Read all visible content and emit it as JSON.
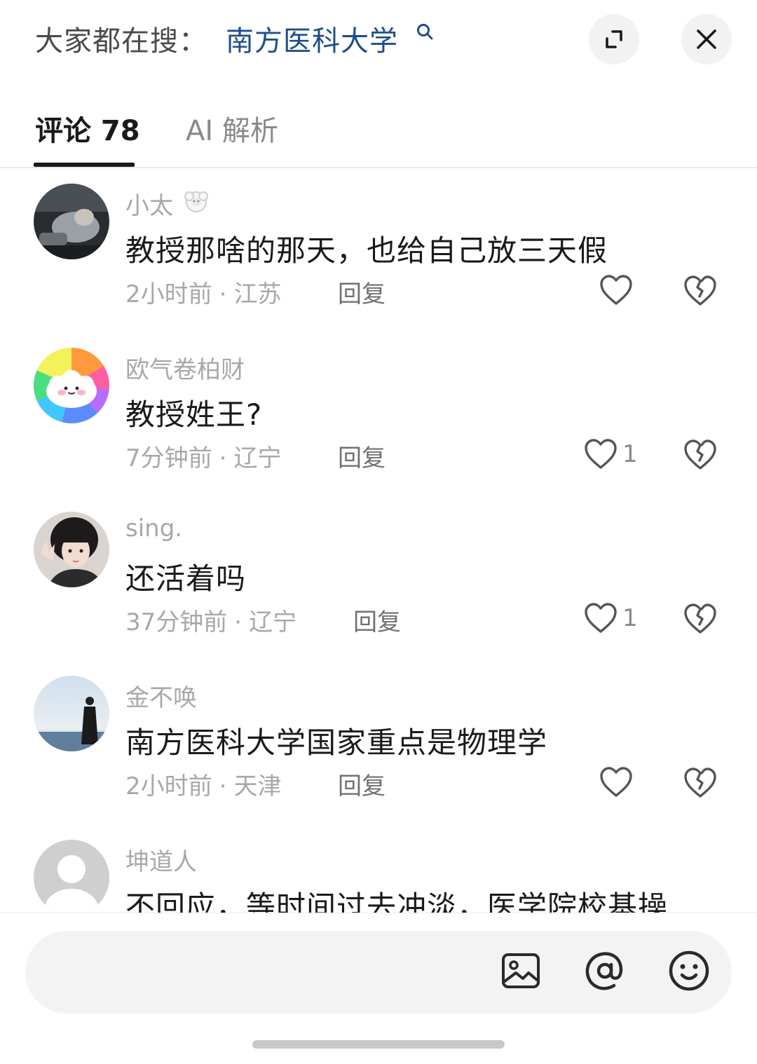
{
  "header": {
    "search_prefix": "大家都在搜：",
    "search_term": "南方医科大学"
  },
  "tabs": [
    {
      "label": "评论 78",
      "active": true
    },
    {
      "label": "AI 解析",
      "active": false
    }
  ],
  "comments": [
    {
      "username": "小太",
      "text": "教授那啥的那天，也给自己放三天假",
      "time": "2小时前",
      "location": "江苏",
      "reply_label": "回复",
      "likes": ""
    },
    {
      "username": "欧气卷柏财",
      "text": "教授姓王?",
      "time": "7分钟前",
      "location": "辽宁",
      "reply_label": "回复",
      "likes": "1"
    },
    {
      "username": "sing.",
      "text": "还活着吗",
      "time": "37分钟前",
      "location": "辽宁",
      "reply_label": "回复",
      "likes": "1"
    },
    {
      "username": "金不唤",
      "text": "南方医科大学国家重点是物理学",
      "time": "2小时前",
      "location": "天津",
      "reply_label": "回复",
      "likes": ""
    },
    {
      "username": "坤道人",
      "text": "不回应，等时间过去冲淡，医学院校基操",
      "time": "",
      "location": "",
      "reply_label": "",
      "likes": ""
    }
  ],
  "input": {
    "placeholder": "",
    "icons": [
      "image-icon",
      "mention-icon",
      "emoji-icon"
    ]
  },
  "colors": {
    "search_term": "#1f4e8c",
    "text_primary": "#1a1a1a",
    "text_secondary": "#a8a8a8"
  }
}
